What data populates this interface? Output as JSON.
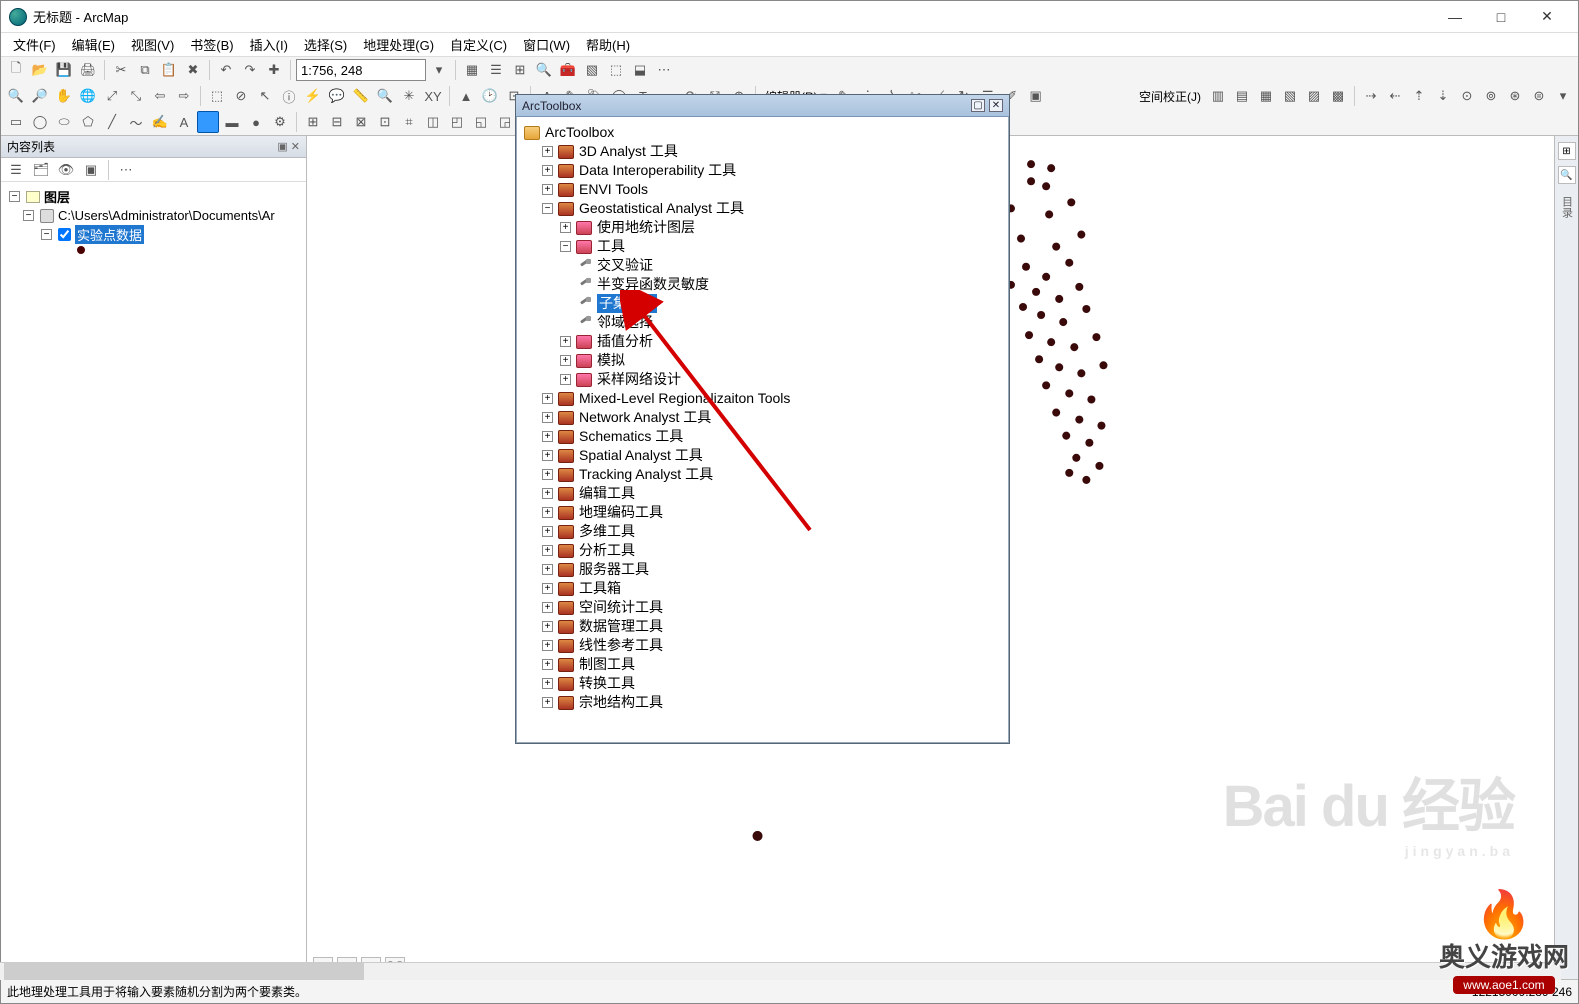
{
  "window": {
    "title": "无标题 - ArcMap",
    "min": "—",
    "max": "□",
    "close": "✕"
  },
  "menu": {
    "file": "文件(F)",
    "edit": "编辑(E)",
    "view": "视图(V)",
    "bookmarks": "书签(B)",
    "insert": "插入(I)",
    "selection": "选择(S)",
    "geoprocessing": "地理处理(G)",
    "customize": "自定义(C)",
    "window": "窗口(W)",
    "help": "帮助(H)"
  },
  "toolbar": {
    "scale": "1:756, 248",
    "editor_label": "编辑器(R)",
    "editor_dropdown": "▾",
    "spatial_adj": "空间校正(J)"
  },
  "toc": {
    "panel_title": "内容列表",
    "close_glyph": "✕",
    "root": "图层",
    "datasource": "C:\\Users\\Administrator\\Documents\\Ar",
    "layer": "实验点数据"
  },
  "arctoolbox": {
    "title": "ArcToolbox",
    "root": "ArcToolbox",
    "items": [
      "3D Analyst 工具",
      "Data Interoperability 工具",
      "ENVI Tools",
      "Geostatistical Analyst 工具",
      "Mixed-Level Regionalizaiton Tools",
      "Network Analyst 工具",
      "Schematics 工具",
      "Spatial Analyst 工具",
      "Tracking Analyst 工具",
      "编辑工具",
      "地理编码工具",
      "多维工具",
      "分析工具",
      "服务器工具",
      "工具箱",
      "空间统计工具",
      "数据管理工具",
      "线性参考工具",
      "制图工具",
      "转换工具",
      "宗地结构工具"
    ],
    "geo_sub": {
      "layer": "使用地统计图层",
      "tools": "工具",
      "tool_list": [
        "交叉验证",
        "半变异函数灵敏度",
        "子集要素",
        "邻域选择"
      ],
      "interp": "插值分析",
      "sim": "模拟",
      "sampling": "采样网络设计"
    }
  },
  "right_strip": {
    "label": "目录"
  },
  "status": {
    "text": "此地理处理工具用于将输入要素随机分割为两个要素类。",
    "coords": "12215909.289  246"
  },
  "watermark": {
    "main": "Bai du 经验",
    "sub": "jingyan.ba"
  },
  "logo": {
    "text": "奥义游戏网",
    "url": "www.aoe1.com"
  }
}
